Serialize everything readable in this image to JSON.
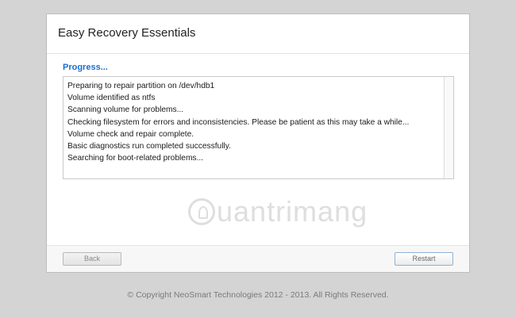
{
  "window": {
    "title": "Easy Recovery Essentials"
  },
  "progress": {
    "label": "Progress..."
  },
  "log": {
    "lines": [
      "Preparing to repair partition on /dev/hdb1",
      "Volume identified as ntfs",
      "Scanning volume for problems...",
      "Checking filesystem for errors and inconsistencies. Please be patient as this may take a while...",
      "Volume check and repair complete.",
      "Basic diagnostics run completed successfully.",
      "Searching for boot-related problems..."
    ]
  },
  "watermark": {
    "text": "uantrimang",
    "icon": "lightbulb-icon"
  },
  "buttons": {
    "back_label": "Back",
    "restart_label": "Restart"
  },
  "footer": {
    "copyright": "© Copyright NeoSmart Technologies 2012 - 2013. All Rights Reserved."
  },
  "colors": {
    "accent": "#1b6fd1",
    "background": "#d4d4d4"
  }
}
